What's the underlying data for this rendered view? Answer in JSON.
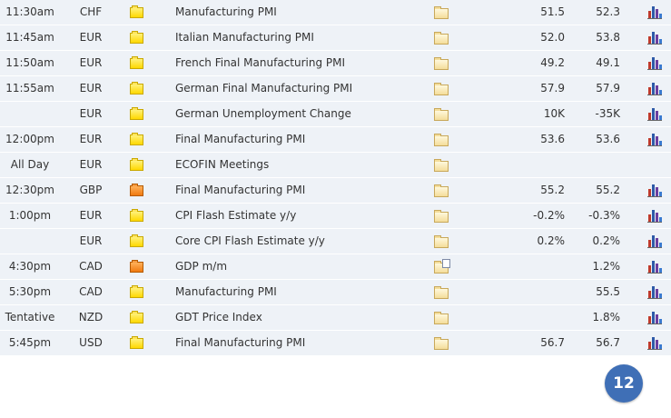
{
  "calendar": {
    "rows": [
      {
        "time": "11:30am",
        "currency": "CHF",
        "impact": "medium",
        "event": "Manufacturing PMI",
        "actual": "51.5",
        "forecast": "52.3",
        "detail_icon": "folder-icon",
        "graph_icon": "bar-chart-icon"
      },
      {
        "time": "11:45am",
        "currency": "EUR",
        "impact": "medium",
        "event": "Italian Manufacturing PMI",
        "actual": "52.0",
        "forecast": "53.8",
        "detail_icon": "folder-icon",
        "graph_icon": "bar-chart-icon"
      },
      {
        "time": "11:50am",
        "currency": "EUR",
        "impact": "medium",
        "event": "French Final Manufacturing PMI",
        "actual": "49.2",
        "forecast": "49.1",
        "detail_icon": "folder-icon",
        "graph_icon": "bar-chart-icon"
      },
      {
        "time": "11:55am",
        "currency": "EUR",
        "impact": "medium",
        "event": "German Final Manufacturing PMI",
        "actual": "57.9",
        "forecast": "57.9",
        "detail_icon": "folder-icon",
        "graph_icon": "bar-chart-icon"
      },
      {
        "time": "",
        "currency": "EUR",
        "impact": "medium",
        "event": "German Unemployment Change",
        "actual": "10K",
        "forecast": "-35K",
        "detail_icon": "folder-icon",
        "graph_icon": "bar-chart-icon"
      },
      {
        "time": "12:00pm",
        "currency": "EUR",
        "impact": "medium",
        "event": "Final Manufacturing PMI",
        "actual": "53.6",
        "forecast": "53.6",
        "detail_icon": "folder-icon",
        "graph_icon": "bar-chart-icon"
      },
      {
        "time": "All Day",
        "currency": "EUR",
        "impact": "medium",
        "event": "ECOFIN Meetings",
        "actual": "",
        "forecast": "",
        "detail_icon": "folder-icon",
        "graph_icon": ""
      },
      {
        "time": "12:30pm",
        "currency": "GBP",
        "impact": "high",
        "event": "Final Manufacturing PMI",
        "actual": "55.2",
        "forecast": "55.2",
        "detail_icon": "folder-icon",
        "graph_icon": "bar-chart-icon"
      },
      {
        "time": "1:00pm",
        "currency": "EUR",
        "impact": "medium",
        "event": "CPI Flash Estimate y/y",
        "actual": "-0.2%",
        "forecast": "-0.3%",
        "detail_icon": "folder-icon",
        "graph_icon": "bar-chart-icon"
      },
      {
        "time": "",
        "currency": "EUR",
        "impact": "medium",
        "event": "Core CPI Flash Estimate y/y",
        "actual": "0.2%",
        "forecast": "0.2%",
        "detail_icon": "folder-icon",
        "graph_icon": "bar-chart-icon"
      },
      {
        "time": "4:30pm",
        "currency": "CAD",
        "impact": "high",
        "event": "GDP m/m",
        "actual": "",
        "forecast": "1.2%",
        "detail_icon": "folder-document-icon",
        "graph_icon": "bar-chart-icon"
      },
      {
        "time": "5:30pm",
        "currency": "CAD",
        "impact": "medium",
        "event": "Manufacturing PMI",
        "actual": "",
        "forecast": "55.5",
        "detail_icon": "folder-icon",
        "graph_icon": "bar-chart-icon"
      },
      {
        "time": "Tentative",
        "currency": "NZD",
        "impact": "medium",
        "event": "GDT Price Index",
        "actual": "",
        "forecast": "1.8%",
        "detail_icon": "folder-icon",
        "graph_icon": "bar-chart-icon"
      },
      {
        "time": "5:45pm",
        "currency": "USD",
        "impact": "medium",
        "event": "Final Manufacturing PMI",
        "actual": "56.7",
        "forecast": "56.7",
        "detail_icon": "folder-icon",
        "graph_icon": "bar-chart-icon"
      }
    ]
  },
  "page_badge": {
    "number": "12"
  },
  "colors": {
    "row_bg": "#eef2f7",
    "badge_bg": "#3f6fb6",
    "impact_medium": "#ffd800",
    "impact_high": "#f07a10"
  }
}
